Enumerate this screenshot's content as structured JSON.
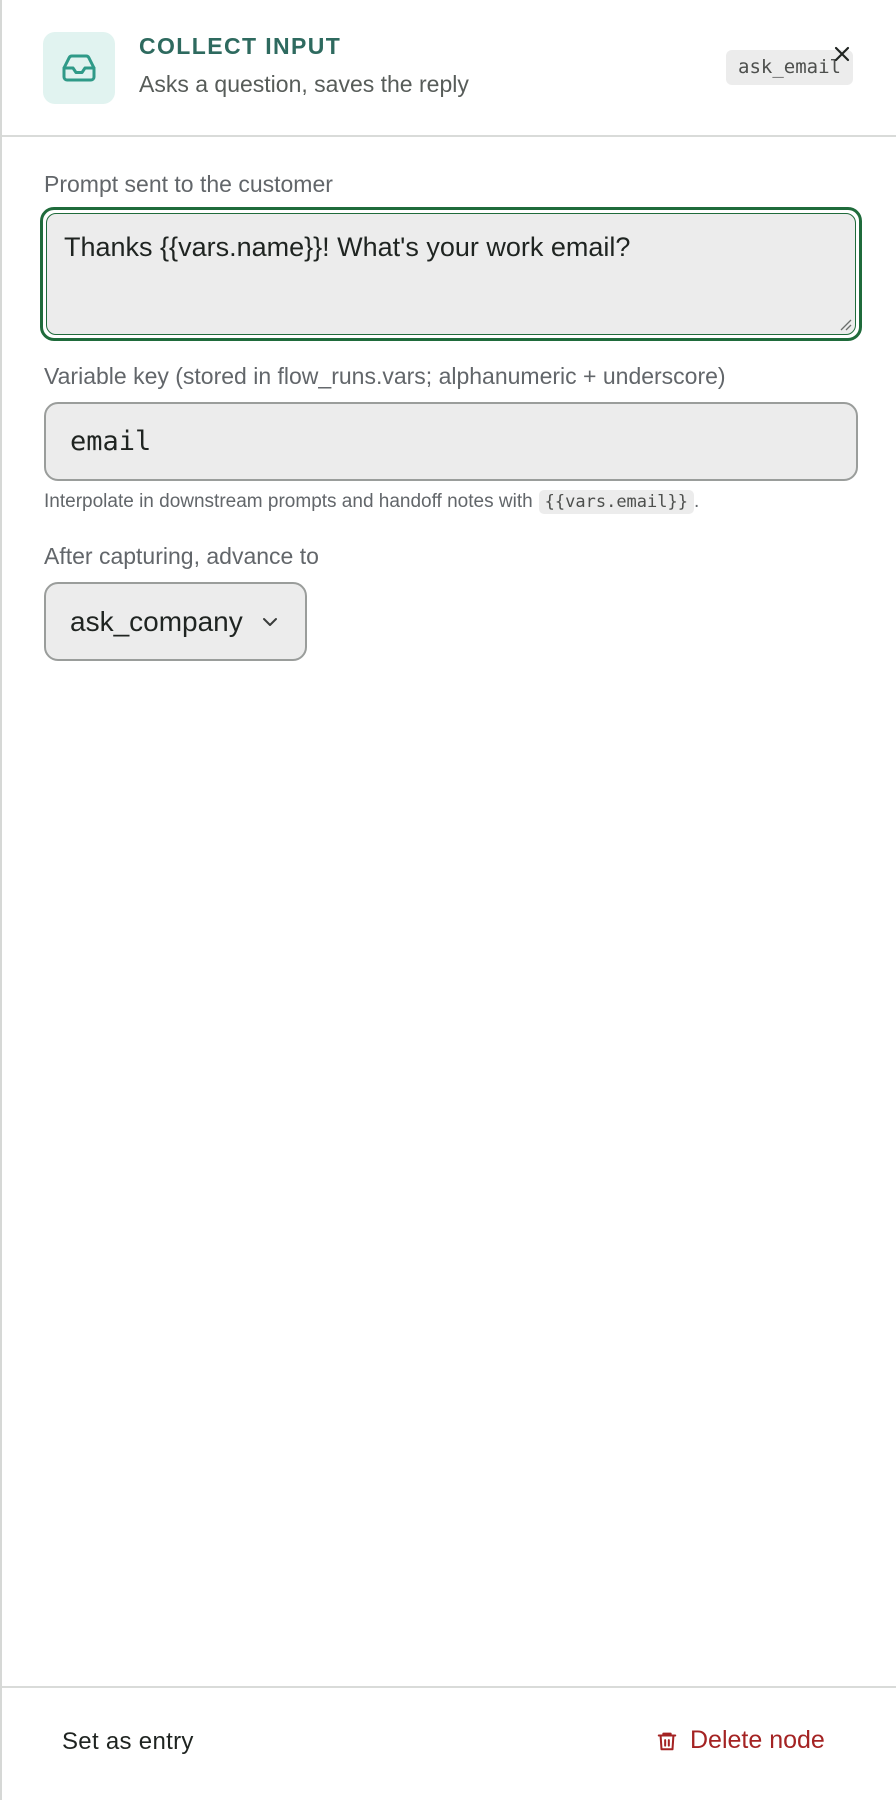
{
  "header": {
    "icon": "inbox-icon",
    "kind": "COLLECT INPUT",
    "subtitle": "Asks a question, saves the reply",
    "node_key": "ask_email",
    "close_icon": "close-icon"
  },
  "prompt": {
    "label": "Prompt sent to the customer",
    "value": "Thanks {{vars.name}}! What's your work email?"
  },
  "variable": {
    "label": "Variable key (stored in flow_runs.vars; alphanumeric + underscore)",
    "value": "email",
    "hint_prefix": "Interpolate in downstream prompts and handoff notes with",
    "hint_code": "{{vars.email}}",
    "hint_suffix": "."
  },
  "next": {
    "label": "After capturing, advance to",
    "selected": "ask_company"
  },
  "footer": {
    "set_entry_label": "Set as entry",
    "delete_label": "Delete node",
    "delete_icon": "trash-icon"
  },
  "colors": {
    "accent": "#1f6b3b",
    "teal": "#2e6a5f",
    "icon_bg": "#e1f3f0",
    "danger": "#a42323"
  }
}
